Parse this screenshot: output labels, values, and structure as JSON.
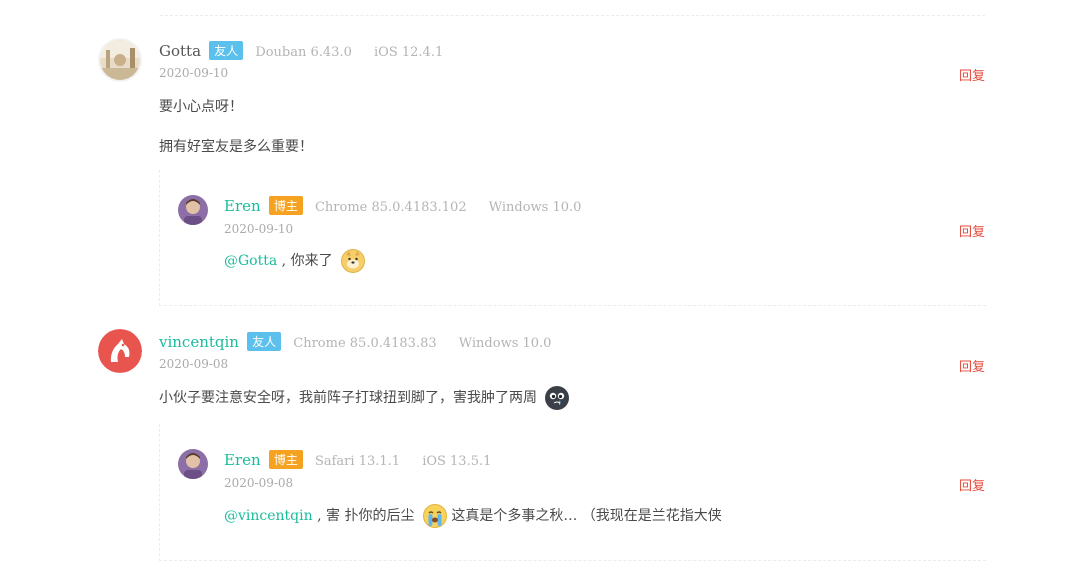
{
  "comments": [
    {
      "author": "Gotta",
      "badge": "友人",
      "browser": "Douban 6.43.0",
      "os": "iOS 12.4.1",
      "date": "2020-09-10",
      "reply": "回复",
      "lines": [
        "要小心点呀！",
        "拥有好室友是多么重要！"
      ],
      "sub": {
        "author": "Eren",
        "badge": "博主",
        "browser": "Chrome 85.0.4183.102",
        "os": "Windows 10.0",
        "date": "2020-09-10",
        "reply": "回复",
        "mention": "@Gotta",
        "text": " , 你来了",
        "emoji": "doge-emoji"
      }
    },
    {
      "author": "vincentqin",
      "badge": "友人",
      "browser": "Chrome 85.0.4183.83",
      "os": "Windows 10.0",
      "date": "2020-09-08",
      "reply": "回复",
      "lines": [
        "小伙子要注意安全呀，我前阵子打球扭到脚了，害我肿了两周"
      ],
      "emoji": "crying-face-emoji",
      "sub": {
        "author": "Eren",
        "badge": "博主",
        "browser": "Safari 13.1.1",
        "os": "iOS 13.5.1",
        "date": "2020-09-08",
        "reply": "回复",
        "mention": "@vincentqin",
        "text": " , 害 扑你的后尘",
        "text_after": "这真是个多事之秋… （我现在是兰花指大侠",
        "emoji": "sobbing-emoji"
      }
    }
  ],
  "colors": {
    "accent": "#1abc9c",
    "reply": "#e64a3b",
    "friend_badge": "#5bc0eb",
    "author_badge": "#f4a21f"
  }
}
